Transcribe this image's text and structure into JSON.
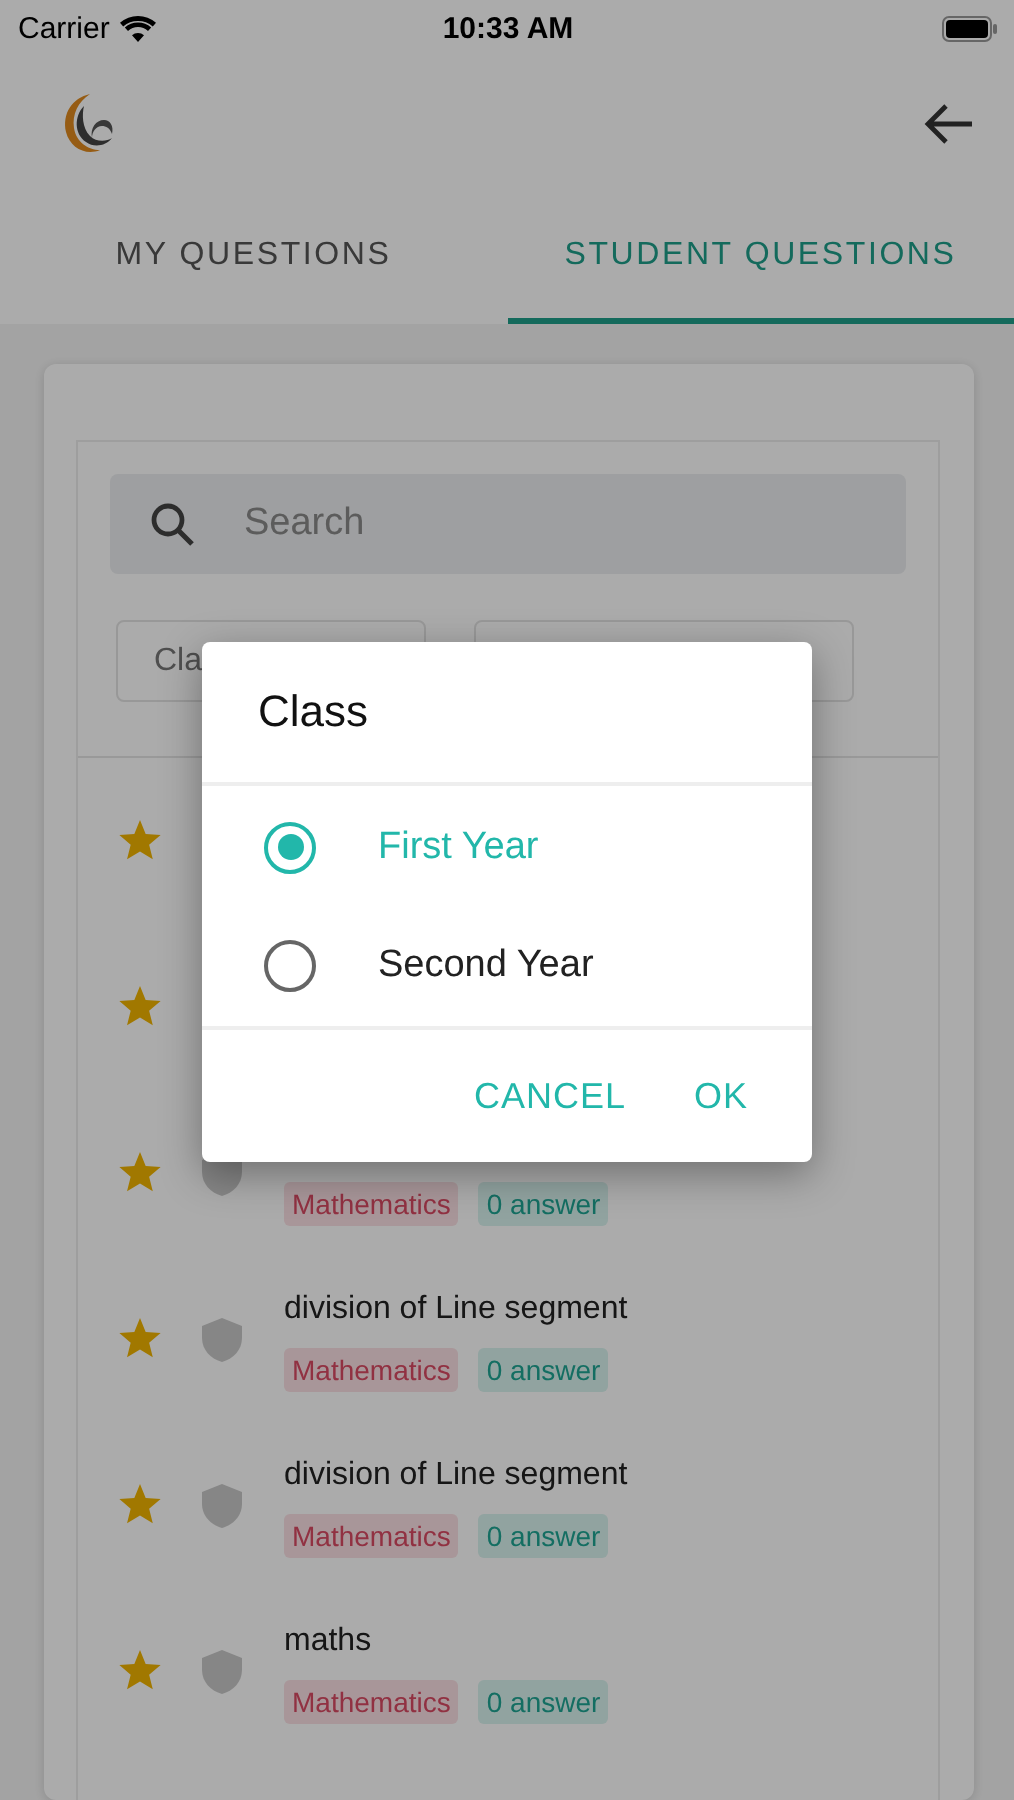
{
  "status_bar": {
    "carrier": "Carrier",
    "time": "10:33 AM"
  },
  "tabs": [
    {
      "label": "MY QUESTIONS",
      "selected": false
    },
    {
      "label": "STUDENT QUESTIONS",
      "selected": true
    }
  ],
  "search": {
    "placeholder": "Search"
  },
  "filters": [
    {
      "kind": "dropdown",
      "label": "Cla"
    },
    {
      "kind": "dropdown"
    }
  ],
  "questions": [
    {
      "starred": true
    },
    {
      "starred": true
    },
    {
      "starred": true,
      "shield": true,
      "subject": "Mathematics",
      "answers": "0 answer"
    },
    {
      "starred": true,
      "shield": true,
      "title": "division of Line segment",
      "subject": "Mathematics",
      "answers": "0 answer"
    },
    {
      "starred": true,
      "shield": true,
      "title": "division of Line segment",
      "subject": "Mathematics",
      "answers": "0 answer"
    },
    {
      "starred": true,
      "shield": true,
      "title": "maths",
      "subject": "Mathematics",
      "answers": "0 answer"
    }
  ],
  "dialog": {
    "title": "Class",
    "options": [
      {
        "label": "First Year",
        "selected": true
      },
      {
        "label": "Second Year",
        "selected": false
      }
    ],
    "buttons": [
      "CANCEL",
      "OK"
    ]
  }
}
